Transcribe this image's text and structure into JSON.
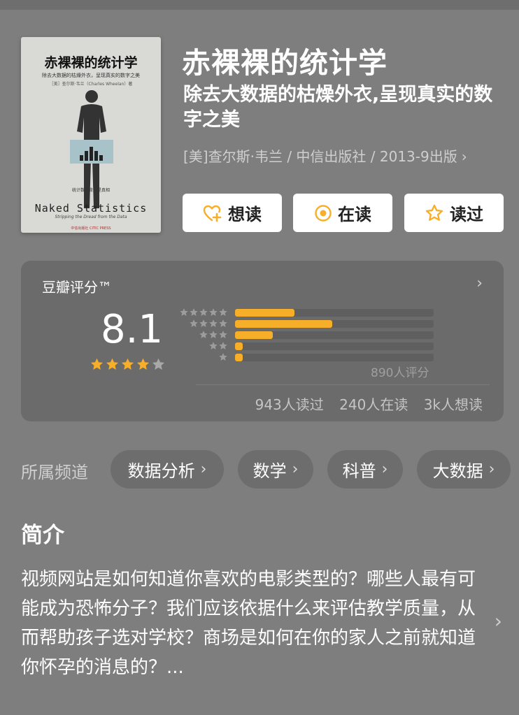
{
  "book": {
    "cover": {
      "title": "赤裸裸的统计学",
      "subtitle": "除去大数据的枯燥外衣，呈现真实的数字之美",
      "author_line": "［美］查尔斯·韦兰（Charles Wheelan）著",
      "blurb": "统计数字背后是真相",
      "english_title": "Naked Statistics",
      "english_subtitle": "Stripping the Dread from the Data",
      "publisher": "中信出版社 CITIC PRESS"
    },
    "title": "赤裸裸的统计学",
    "subtitle": "除去大数据的枯燥外衣,呈现真实的数字之美",
    "meta": "[美]查尔斯·韦兰 / 中信出版社 / 2013-9出版",
    "meta_chevron": "›"
  },
  "actions": [
    {
      "label": "想读",
      "icon": "heart-plus-icon"
    },
    {
      "label": "在读",
      "icon": "circle-dot-icon"
    },
    {
      "label": "读过",
      "icon": "star-outline-icon"
    }
  ],
  "rating": {
    "label": "豆瓣评分™",
    "chevron": "›",
    "score": "8.1",
    "stars_value": 4,
    "distribution": [
      {
        "stars": 5,
        "fraction": 0.3
      },
      {
        "stars": 4,
        "fraction": 0.49
      },
      {
        "stars": 3,
        "fraction": 0.19
      },
      {
        "stars": 2,
        "fraction": 0.04
      },
      {
        "stars": 1,
        "fraction": 0.04
      }
    ],
    "count": "890人评分",
    "read": "943人读过",
    "reading": "240人在读",
    "want": "3k人想读"
  },
  "channels": {
    "label": "所属频道",
    "items": [
      "数据分析",
      "数学",
      "科普",
      "大数据"
    ],
    "chevron": "›"
  },
  "intro": {
    "title": "简介",
    "text": "视频网站是如何知道你喜欢的电影类型的？哪些人最有可能成为恐怖分子？我们应该依据什么来评估教学质量，从而帮助孩子选对学校？商场是如何在你的家人之前就知道你怀孕的消息的？...",
    "chevron": "›"
  },
  "colors": {
    "background": "#7e7e7e",
    "card": "#6b6b6b",
    "accent_orange": "#f7ae29",
    "button_bg": "#ffffff"
  }
}
